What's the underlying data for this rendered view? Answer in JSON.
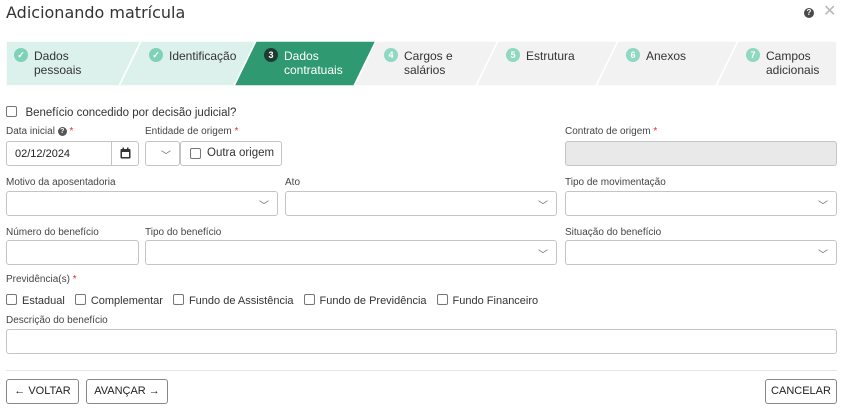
{
  "header": {
    "title": "Adicionando matrícula",
    "help_glyph": "?",
    "close_glyph": "✕"
  },
  "colors": {
    "done": "#dcf1ec",
    "active": "#2f9a72",
    "pending": "#f2f2f2",
    "badge_done": "#7fd1b8",
    "badge_pending": "#8fd8c1",
    "required": "#d33"
  },
  "stepper": {
    "steps": [
      {
        "badge": "✓",
        "label": "Dados\npessoais",
        "status": "done"
      },
      {
        "badge": "✓",
        "label": "Identificação",
        "status": "done"
      },
      {
        "badge": "3",
        "label": "Dados\ncontratuais",
        "status": "active"
      },
      {
        "badge": "4",
        "label": "Cargos e\nsalários",
        "status": "pending"
      },
      {
        "badge": "5",
        "label": "Estrutura",
        "status": "pending"
      },
      {
        "badge": "6",
        "label": "Anexos",
        "status": "pending"
      },
      {
        "badge": "7",
        "label": "Campos\nadicionais",
        "status": "pending"
      }
    ]
  },
  "form": {
    "judicial_checkbox_label": "Benefício concedido por decisão judicial?",
    "data_inicial": {
      "label": "Data inicial",
      "value": "02/12/2024",
      "required": "*"
    },
    "entidade_origem": {
      "label": "Entidade de origem",
      "required": "*",
      "outra_origem_label": "Outra origem"
    },
    "contrato_origem": {
      "label": "Contrato de origem",
      "required": "*"
    },
    "motivo_aposentadoria": {
      "label": "Motivo da aposentadoria"
    },
    "ato": {
      "label": "Ato"
    },
    "tipo_movimentacao": {
      "label": "Tipo de movimentação"
    },
    "numero_beneficio": {
      "label": "Número do benefício"
    },
    "tipo_beneficio": {
      "label": "Tipo do benefício"
    },
    "situacao_beneficio": {
      "label": "Situação do benefício"
    },
    "previdencias": {
      "label": "Previdência(s)",
      "required": "*",
      "options": [
        "Estadual",
        "Complementar",
        "Fundo de Assistência",
        "Fundo de Previdência",
        "Fundo Financeiro"
      ]
    },
    "descricao_beneficio": {
      "label": "Descrição do benefício"
    }
  },
  "footer": {
    "back_label": "VOLTAR",
    "next_label": "AVANÇAR",
    "cancel_label": "CANCELAR"
  }
}
